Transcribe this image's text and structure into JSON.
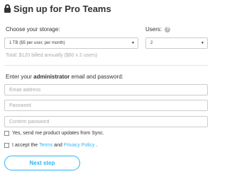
{
  "header": {
    "title": "Sign up for Pro Teams",
    "icon": "lock-icon"
  },
  "storage": {
    "label": "Choose your storage:",
    "selected": "1 TB ($5 per user, per month)",
    "total": "Total: $120 billed annually ($60 x 2 users)"
  },
  "users": {
    "label": "Users:",
    "selected": "2",
    "help_icon": "help-icon"
  },
  "account": {
    "label_prefix": "Enter your ",
    "label_bold": "administrator",
    "label_suffix": " email and password:",
    "email_placeholder": "Email address",
    "password_placeholder": "Password",
    "confirm_placeholder": "Confirm password"
  },
  "checks": {
    "updates": "Yes, send me product updates from Sync.",
    "accept_prefix": "I accept the ",
    "terms": "Terms",
    "and": " and ",
    "privacy": "Privacy Policy",
    "period": " ."
  },
  "next_button": "Next step",
  "colors": {
    "accent": "#29b6f6",
    "text": "#333333",
    "muted": "#aaaaaa",
    "border": "#cccccc"
  }
}
